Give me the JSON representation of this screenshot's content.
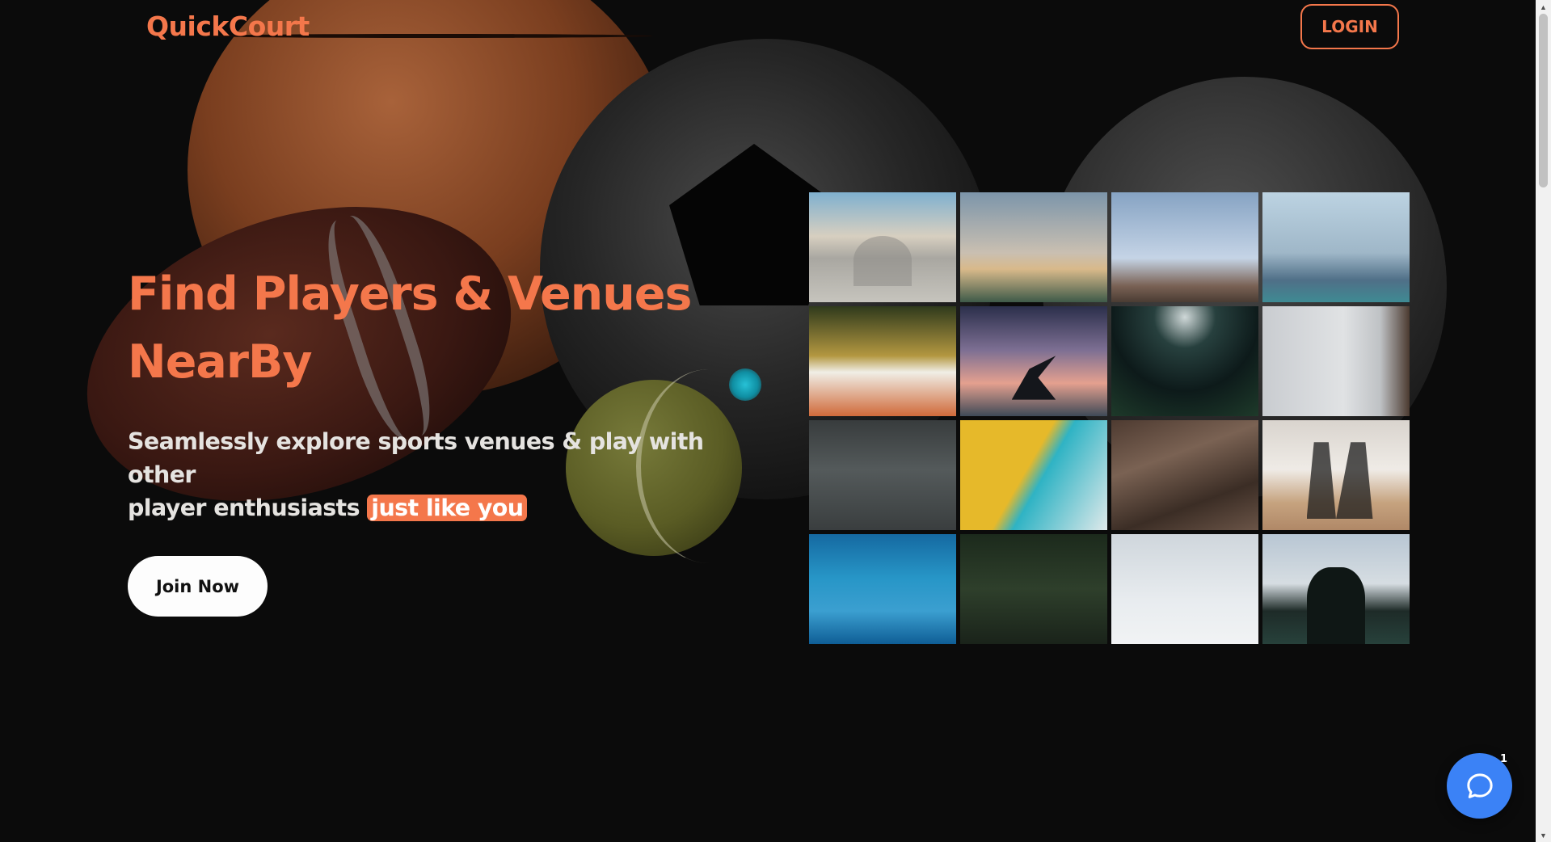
{
  "app": {
    "logo_text": "QuickCourt",
    "accent_color": "#f4774b"
  },
  "nav": {
    "login_label": "LOGIN"
  },
  "hero": {
    "title_line1": "Find Players & Venues",
    "title_line2": "NearBy",
    "subtitle_line1": "Seamlessly explore sports venues & play with other",
    "subtitle_line2_prefix": "player enthusiasts",
    "subtitle_highlight": "just like you",
    "cta_label": "Join Now"
  },
  "gallery": {
    "tiles": [
      {
        "icon": "skateboard-park-photo"
      },
      {
        "icon": "mountain-bike-photo"
      },
      {
        "icon": "basketball-shot-photo"
      },
      {
        "icon": "basketball-hoop-fence-photo"
      },
      {
        "icon": "tennis-racket-ball-photo"
      },
      {
        "icon": "yoga-pose-photo"
      },
      {
        "icon": "night-football-field-photo"
      },
      {
        "icon": "basketball-under-hoop-photo"
      },
      {
        "icon": "weightlifting-barbell-photo"
      },
      {
        "icon": "climbing-wall-photo"
      },
      {
        "icon": "rock-climbing-photo"
      },
      {
        "icon": "volleyball-game-photo"
      },
      {
        "icon": "swimming-pool-lanes-photo"
      },
      {
        "icon": "archery-arrow-photo"
      },
      {
        "icon": "snowboarding-photo"
      },
      {
        "icon": "soccer-player-photo"
      }
    ]
  },
  "chat": {
    "icon": "chat-bubble-icon",
    "badge": "1",
    "color": "#3b82f6"
  }
}
